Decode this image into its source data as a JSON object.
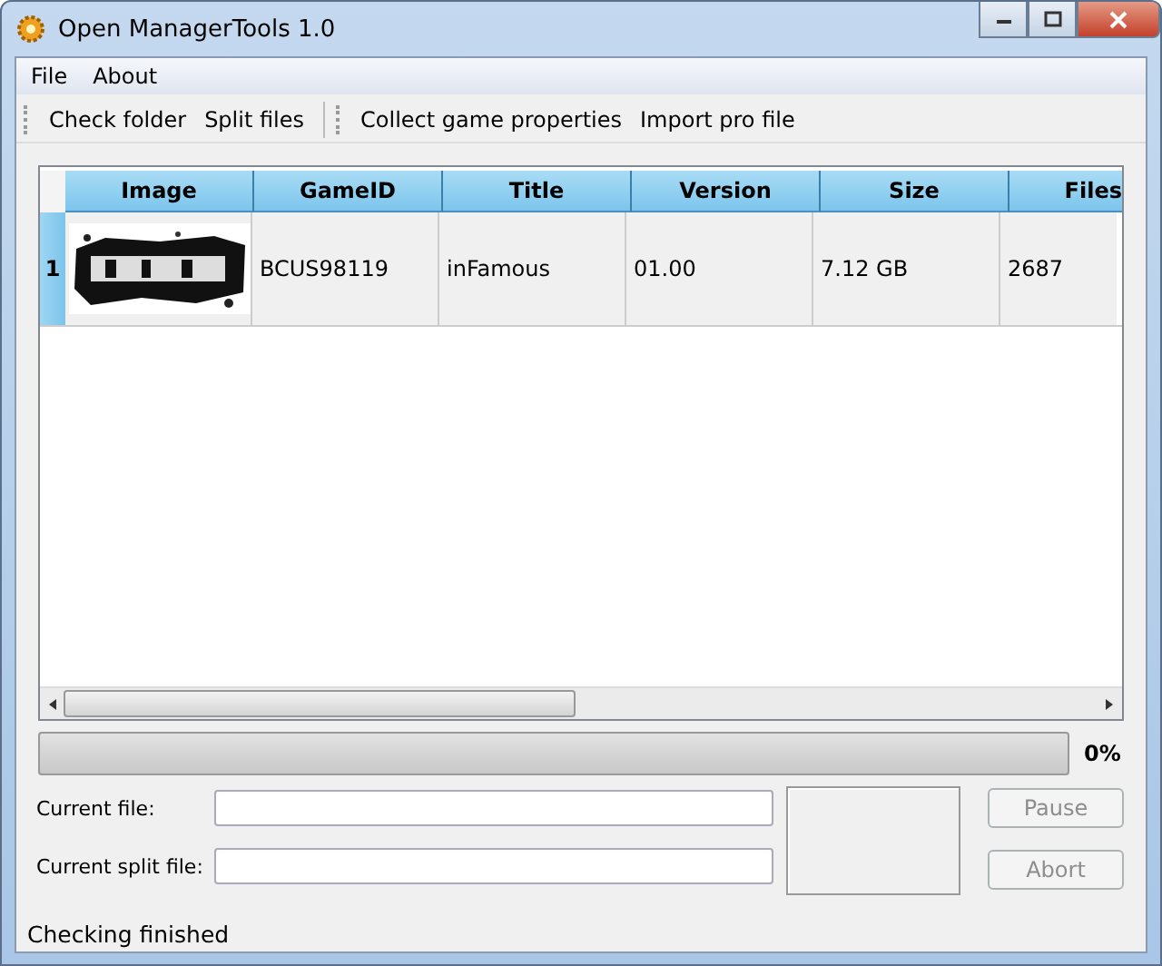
{
  "window": {
    "title": "Open ManagerTools 1.0"
  },
  "menu": [
    "File",
    "About"
  ],
  "toolbar": [
    [
      "Check folder",
      "Split files"
    ],
    [
      "Collect game properties",
      "Import pro file"
    ]
  ],
  "table": {
    "columns": [
      "Image",
      "GameID",
      "Title",
      "Version",
      "Size",
      "Files"
    ],
    "rows": [
      {
        "number": "1",
        "selected": true,
        "cells": [
          {
            "kind": "picture"
          },
          {
            "text": "BCUS98119"
          },
          {
            "text": "inFamous"
          },
          {
            "text": "01.00"
          },
          {
            "text": "7.12 GB"
          },
          {
            "text": "2687"
          }
        ]
      }
    ]
  },
  "progress": {
    "level": 0,
    "reading": "0%"
  },
  "fields": [
    {
      "label": "Current file:"
    },
    {
      "label": "Current split file:"
    }
  ],
  "buttons": [
    {
      "label": "Pause",
      "disabled": true
    },
    {
      "label": "Abort",
      "disabled": true
    }
  ],
  "status_bar": "Checking finished"
}
